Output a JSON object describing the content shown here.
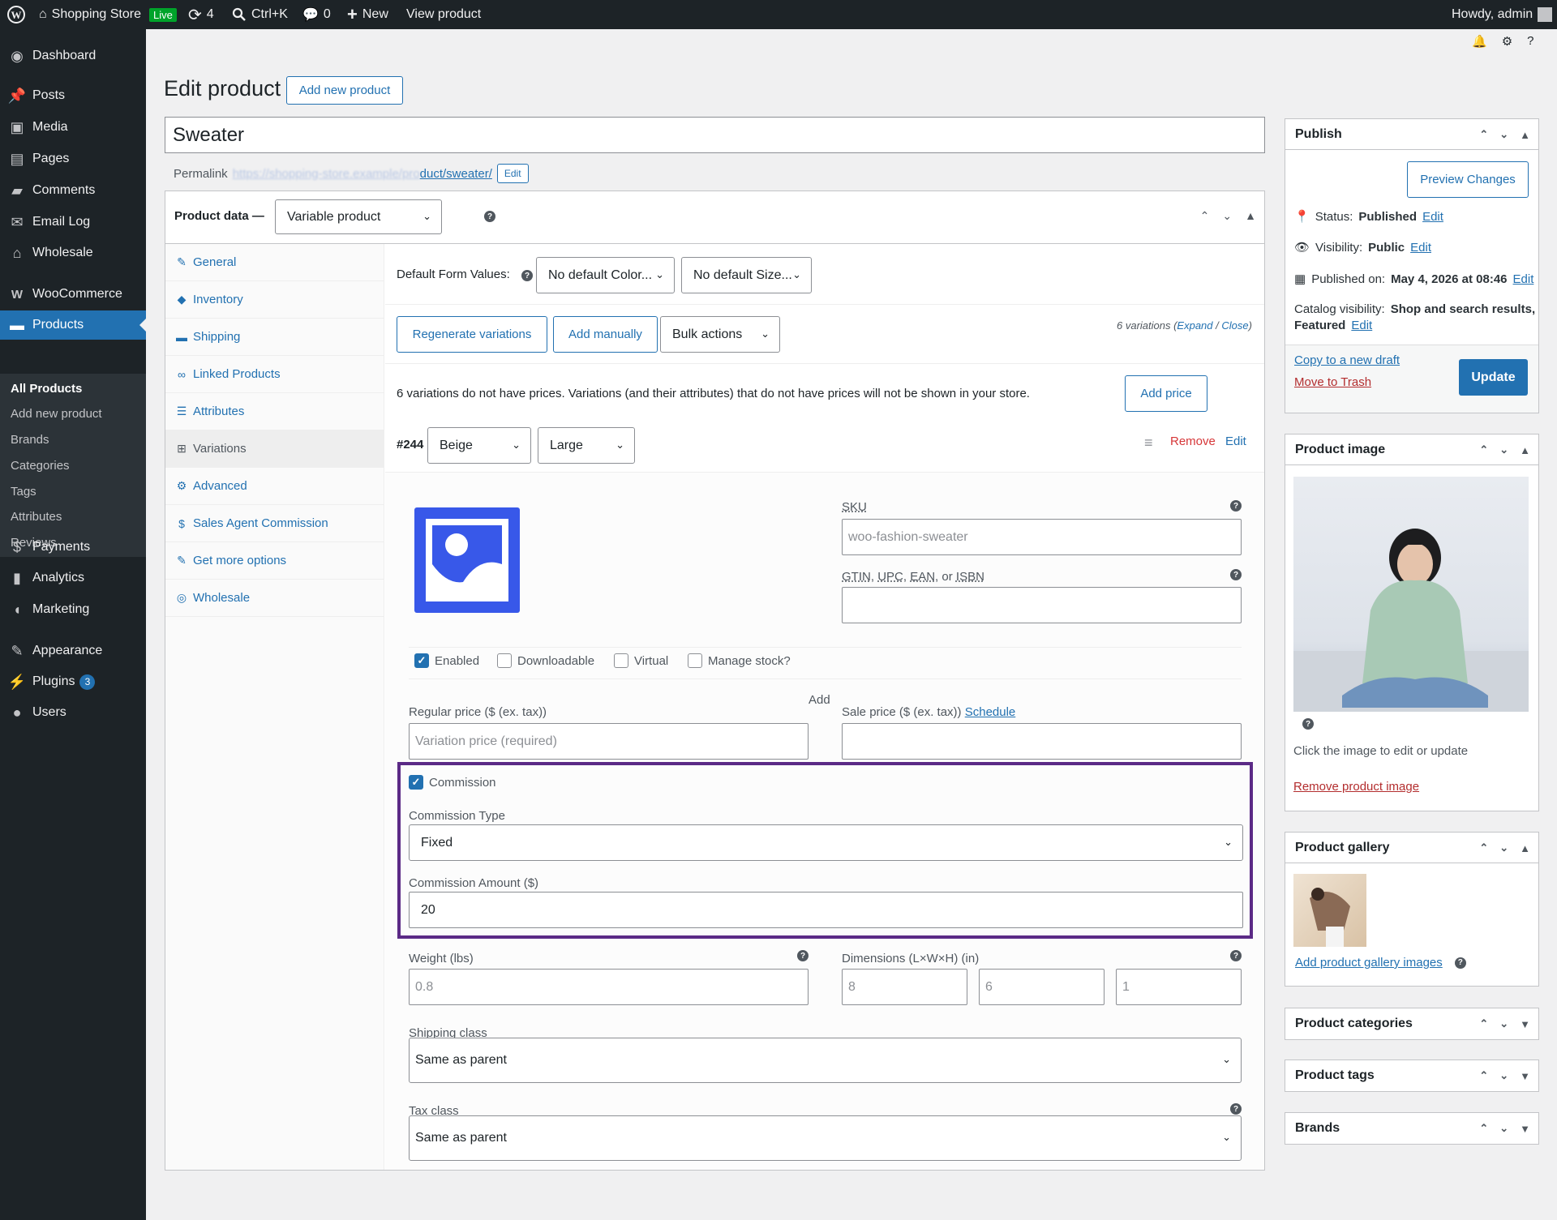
{
  "topbar": {
    "site_name": "Shopping Store",
    "live_badge": "Live",
    "updates_count": "4",
    "search_shortcut": "Ctrl+K",
    "comments_count": "0",
    "new_label": "New",
    "view_product": "View product",
    "howdy": "Howdy, admin"
  },
  "sidebar": {
    "dashboard": "Dashboard",
    "posts": "Posts",
    "media": "Media",
    "pages": "Pages",
    "comments": "Comments",
    "email_log": "Email Log",
    "wholesale": "Wholesale",
    "woocommerce": "WooCommerce",
    "products": "Products",
    "submenu": [
      "All Products",
      "Add new product",
      "Brands",
      "Categories",
      "Tags",
      "Attributes",
      "Reviews"
    ],
    "payments": "Payments",
    "analytics": "Analytics",
    "marketing": "Marketing",
    "appearance": "Appearance",
    "plugins": "Plugins",
    "plugins_badge": "3",
    "users": "Users"
  },
  "page": {
    "title": "Edit product",
    "add_new": "Add new product",
    "product_title": "Sweater",
    "permalink_label": "Permalink",
    "permalink_hidden": "https://shopping-store.example/pro",
    "permalink_slug": "duct/sweater/",
    "permalink_edit": "Edit"
  },
  "product_data": {
    "label": "Product data —",
    "type_value": "Variable product",
    "tabs": [
      "General",
      "Inventory",
      "Shipping",
      "Linked Products",
      "Attributes",
      "Variations",
      "Advanced",
      "Sales Agent Commission",
      "Get more options",
      "Wholesale"
    ],
    "default_form_values_label": "Default Form Values:",
    "default_color": "No default Color...",
    "default_size": "No default Size...",
    "regenerate": "Regenerate variations",
    "add_manually": "Add manually",
    "bulk_actions": "Bulk actions",
    "variations_count_text": "6 variations (",
    "expand": "Expand",
    "slash": " / ",
    "close": "Close",
    "close_paren": ")",
    "notice": "6 variations do not have prices. Variations (and their attributes) that do not have prices will not be shown in your store.",
    "add_price": "Add price",
    "variation": {
      "id": "#244",
      "color": "Beige",
      "size": "Large",
      "remove": "Remove",
      "edit": "Edit",
      "sku_label": "SKU",
      "sku_placeholder": "woo-fashion-sweater",
      "gtin_label_gtin": "GTIN",
      "gtin_label_upc": "UPC",
      "gtin_label_ean": "EAN",
      "gtin_label_or": "or",
      "gtin_label_isbn": "ISBN",
      "enabled": "Enabled",
      "downloadable": "Downloadable",
      "virtual": "Virtual",
      "manage_stock": "Manage stock?",
      "add_label": "Add",
      "regular_price_label": "Regular price ($ (ex. tax))",
      "regular_price_placeholder": "Variation price (required)",
      "sale_price_label": "Sale price ($ (ex. tax))",
      "schedule": "Schedule",
      "commission_label": "Commission",
      "commission_type_label": "Commission Type",
      "commission_type_value": "Fixed",
      "commission_amount_label": "Commission Amount ($)",
      "commission_amount_value": "20",
      "weight_label": "Weight (lbs)",
      "weight_placeholder": "0.8",
      "dimensions_label": "Dimensions (L×W×H) (in)",
      "dim_l": "8",
      "dim_w": "6",
      "dim_h": "1",
      "shipping_class_label": "Shipping class",
      "shipping_class_value": "Same as parent",
      "tax_class_label": "Tax class",
      "tax_class_value": "Same as parent"
    }
  },
  "publish": {
    "title": "Publish",
    "preview": "Preview Changes",
    "status_label": "Status:",
    "status_value": "Published",
    "visibility_label": "Visibility:",
    "visibility_value": "Public",
    "published_label": "Published on:",
    "published_value": "May 4, 2026 at 08:46",
    "edit": "Edit",
    "catalog_label": "Catalog visibility:",
    "catalog_value": "Shop and search results,",
    "catalog_value2": "Featured",
    "copy_draft": "Copy to a new draft",
    "trash": "Move to Trash",
    "update": "Update"
  },
  "product_image": {
    "title": "Product image",
    "hint": "Click the image to edit or update",
    "remove": "Remove product image"
  },
  "gallery": {
    "title": "Product gallery",
    "add": "Add product gallery images"
  },
  "categories": {
    "title": "Product categories"
  },
  "tags": {
    "title": "Product tags"
  },
  "brands": {
    "title": "Brands"
  },
  "colors": {
    "accent": "#2271b1",
    "highlight_border": "#5b2a86",
    "remove": "#d63638"
  }
}
